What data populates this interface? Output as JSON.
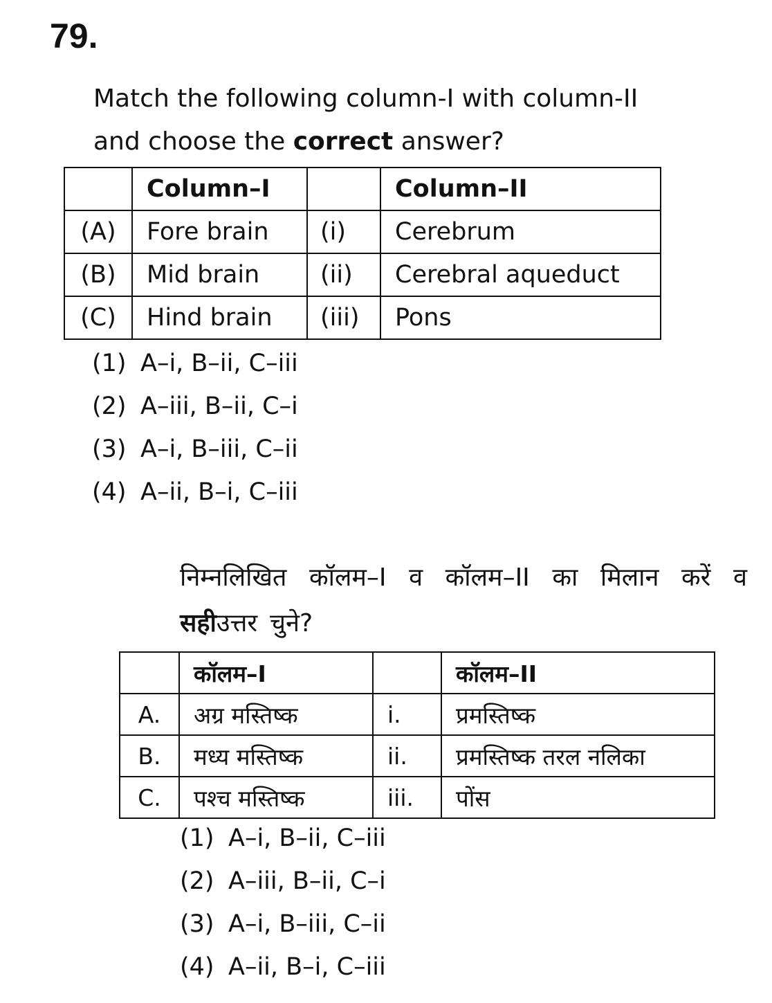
{
  "question_number": "79.",
  "english": {
    "stem_line1": "Match the following column-I with column-II",
    "stem_line2_pre": "and choose the",
    "stem_line2_bold": "correct",
    "stem_line2_post": "answer?",
    "table": {
      "header_col1": "Column–I",
      "header_col2": "Column–II",
      "rows": [
        {
          "label": "(A)",
          "col1": "Fore brain",
          "idx": "(i)",
          "col2": "Cerebrum"
        },
        {
          "label": "(B)",
          "col1": "Mid brain",
          "idx": "(ii)",
          "col2": "Cerebral aqueduct"
        },
        {
          "label": "(C)",
          "col1": "Hind brain",
          "idx": "(iii)",
          "col2": "Pons"
        }
      ]
    },
    "options": [
      {
        "num": "(1)",
        "text": "A–i, B–ii, C–iii"
      },
      {
        "num": "(2)",
        "text": "A–iii, B–ii, C–i"
      },
      {
        "num": "(3)",
        "text": "A–i, B–iii, C–ii"
      },
      {
        "num": "(4)",
        "text": "A–ii, B–i, C–iii"
      }
    ]
  },
  "hindi": {
    "line1_words": [
      "निम्नलिखित",
      "कॉलम–I",
      "व",
      "कॉलम–II",
      "का",
      "मिलान",
      "करें",
      "व"
    ],
    "line2_bold": "सही",
    "line2_words": [
      "उत्तर",
      "चुने?"
    ],
    "table": {
      "header_col1": "कॉलम–I",
      "header_col2": "कॉलम–II",
      "rows": [
        {
          "label": "A.",
          "col1": "अग्र मस्तिष्क",
          "idx": "i.",
          "col2": "प्रमस्तिष्क"
        },
        {
          "label": "B.",
          "col1": "मध्य मस्तिष्क",
          "idx": "ii.",
          "col2": "प्रमस्तिष्क तरल नलिका"
        },
        {
          "label": "C.",
          "col1": "पश्च मस्तिष्क",
          "idx": "iii.",
          "col2": "पोंस"
        }
      ]
    },
    "options": [
      {
        "num": "(1)",
        "text": "A–i, B–ii, C–iii"
      },
      {
        "num": "(2)",
        "text": "A–iii, B–ii, C–i"
      },
      {
        "num": "(3)",
        "text": "A–i, B–iii, C–ii"
      },
      {
        "num": "(4)",
        "text": "A–ii, B–i, C–iii"
      }
    ]
  }
}
